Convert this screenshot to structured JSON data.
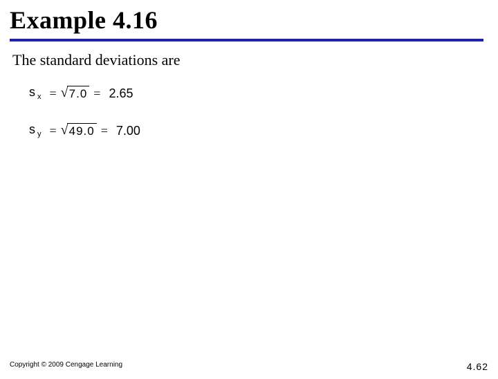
{
  "title": "Example 4.16",
  "body_line": "The standard deviations are",
  "equations": [
    {
      "var_main": "s",
      "var_sub": "x",
      "radicand": "7.0",
      "value": "2.65"
    },
    {
      "var_main": "s",
      "var_sub": "y",
      "radicand": "49.0",
      "value": "7.00"
    }
  ],
  "footer": {
    "copyright": "Copyright © 2009 Cengage Learning",
    "page": "4.62"
  }
}
